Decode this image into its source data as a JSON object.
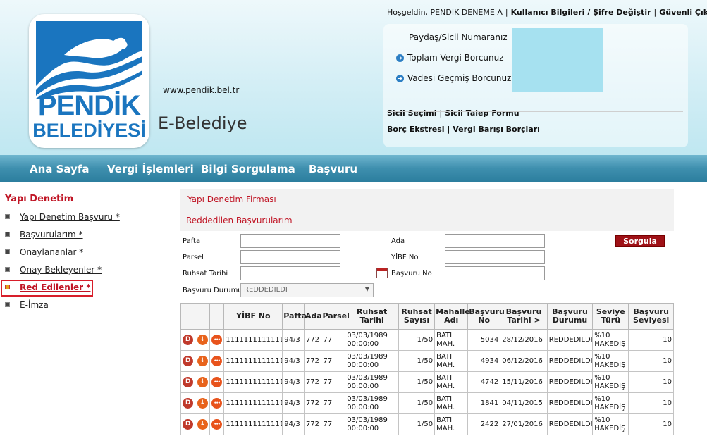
{
  "header": {
    "logo_line1": "PENDİK",
    "logo_line2": "BELEDİYESİ",
    "url": "www.pendik.bel.tr",
    "subtitle": "E-Belediye",
    "welcome": "Hoşgeldin, PENDİK DENEME A",
    "user_info_link": "Kullanıcı Bilgileri / Şifre Değiştir",
    "logout_link": "Güvenli Çıkış"
  },
  "panel": {
    "sicil_label": "Paydaş/Sicil Numaranız",
    "total_debt_label": "Toplam Vergi Borcunuz",
    "overdue_label": "Vadesi Geçmiş Borcunuz",
    "links_row1": [
      "Sicil Seçimi",
      "Sicil Talep Formu"
    ],
    "links_row2": [
      "Borç Ekstresi",
      "Vergi Barışı Borçları"
    ]
  },
  "nav": [
    "Ana Sayfa",
    "Vergi İşlemleri",
    "Bilgi Sorgulama",
    "Başvuru"
  ],
  "sidebar": {
    "title": "Yapı Denetim",
    "items": [
      {
        "label": "Yapı Denetim Başvuru *"
      },
      {
        "label": "Başvurularım *"
      },
      {
        "label": "Onaylananlar *"
      },
      {
        "label": "Onay Bekleyenler *"
      },
      {
        "label": "Red Edilenler *"
      },
      {
        "label": "E-İmza"
      }
    ]
  },
  "main": {
    "section_title": "Yapı Denetim Firması",
    "page_title": "Reddedilen Başvurularım",
    "form": {
      "pafta_label": "Pafta",
      "ada_label": "Ada",
      "parsel_label": "Parsel",
      "yibf_label": "YİBF No",
      "ruhsat_label": "Ruhsat Tarihi",
      "basvuru_no_label": "Başvuru No",
      "durum_label": "Başvuru Durumu",
      "durum_value": "REDDEDILDI",
      "search_button": "Sorgula"
    },
    "table": {
      "headers": [
        "",
        "",
        "",
        "YİBF No",
        "Pafta",
        "Ada",
        "Parsel",
        "Ruhsat Tarihi",
        "Ruhsat Sayısı",
        "Mahalle Adı",
        "Başvuru No",
        "Başvuru Tarihi >",
        "Başvuru Durumu",
        "Seviye Türü",
        "Başvuru Seviyesi"
      ],
      "rows": [
        {
          "yibf": "1111111111111",
          "pafta": "94/3",
          "ada": "772",
          "parsel": "77",
          "ruhsat_tarihi": "03/03/1989 00:00:00",
          "ruhsat_sayisi": "1/50",
          "mahalle": "BATI MAH.",
          "basvuru_no": "5034",
          "basvuru_tarihi": "28/12/2016",
          "durum": "REDDEDILDI",
          "seviye_turu": "%10 HAKEDİŞ",
          "seviye": "10"
        },
        {
          "yibf": "1111111111111",
          "pafta": "94/3",
          "ada": "772",
          "parsel": "77",
          "ruhsat_tarihi": "03/03/1989 00:00:00",
          "ruhsat_sayisi": "1/50",
          "mahalle": "BATI MAH.",
          "basvuru_no": "4934",
          "basvuru_tarihi": "06/12/2016",
          "durum": "REDDEDILDI",
          "seviye_turu": "%10 HAKEDİŞ",
          "seviye": "10"
        },
        {
          "yibf": "1111111111111",
          "pafta": "94/3",
          "ada": "772",
          "parsel": "77",
          "ruhsat_tarihi": "03/03/1989 00:00:00",
          "ruhsat_sayisi": "1/50",
          "mahalle": "BATI MAH.",
          "basvuru_no": "4742",
          "basvuru_tarihi": "15/11/2016",
          "durum": "REDDEDILDI",
          "seviye_turu": "%10 HAKEDİŞ",
          "seviye": "10"
        },
        {
          "yibf": "1111111111111",
          "pafta": "94/3",
          "ada": "772",
          "parsel": "77",
          "ruhsat_tarihi": "03/03/1989 00:00:00",
          "ruhsat_sayisi": "1/50",
          "mahalle": "BATI MAH.",
          "basvuru_no": "1841",
          "basvuru_tarihi": "04/11/2015",
          "durum": "REDDEDILDI",
          "seviye_turu": "%10 HAKEDİŞ",
          "seviye": "10"
        },
        {
          "yibf": "1111111111111",
          "pafta": "94/3",
          "ada": "772",
          "parsel": "77",
          "ruhsat_tarihi": "03/03/1989 00:00:00",
          "ruhsat_sayisi": "1/50",
          "mahalle": "BATI MAH.",
          "basvuru_no": "2422",
          "basvuru_tarihi": "27/01/2016",
          "durum": "REDDEDILDI",
          "seviye_turu": "%10 HAKEDİŞ",
          "seviye": "10"
        }
      ]
    }
  },
  "colors": {
    "accent_red": "#c01525",
    "brand_blue": "#1a75bf",
    "nav_blue": "#3e8fae"
  }
}
